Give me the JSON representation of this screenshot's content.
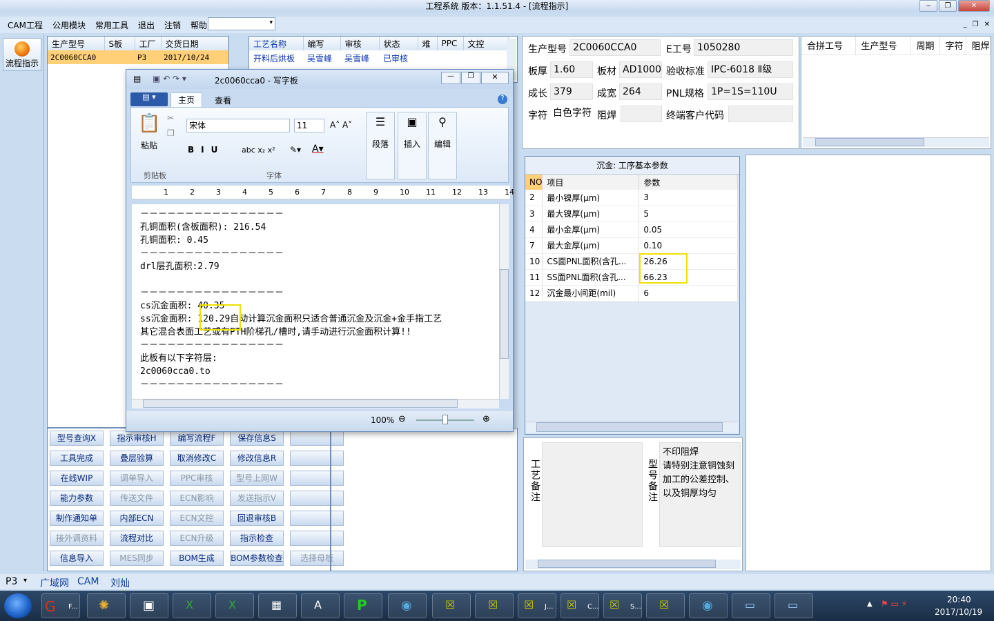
{
  "window": {
    "title": "工程系统   版本：1.1.51.4 - [流程指示]"
  },
  "menu": [
    "CAM工程",
    "公用模块",
    "常用工具",
    "退出",
    "注销",
    "帮助"
  ],
  "sidebar": {
    "flow_label": "流程指示"
  },
  "orders": {
    "headers": [
      "生产型号",
      "S板",
      "工厂",
      "交货日期"
    ],
    "row": [
      "2C0060CCA0",
      "",
      "P3",
      "2017/10/24"
    ]
  },
  "process": {
    "headers": [
      "工艺名称",
      "编写",
      "审核",
      "状态",
      "难",
      "PPC",
      "文控"
    ],
    "row": [
      "开料后烘板",
      "吴雪峰",
      "吴雪峰",
      "已审核",
      "",
      "",
      ""
    ]
  },
  "buttons": [
    [
      {
        "l": "型号查询X",
        "d": false
      },
      {
        "l": "指示审核H",
        "d": false
      },
      {
        "l": "编写流程F",
        "d": false
      },
      {
        "l": "保存信息S",
        "d": false
      },
      {
        "l": "",
        "d": false
      }
    ],
    [
      {
        "l": "工具完成",
        "d": false
      },
      {
        "l": "叠层验算",
        "d": false
      },
      {
        "l": "取消修改C",
        "d": false
      },
      {
        "l": "修改信息R",
        "d": false
      },
      {
        "l": "",
        "d": false
      }
    ],
    [
      {
        "l": "在线WIP",
        "d": false
      },
      {
        "l": "调单导入",
        "d": true
      },
      {
        "l": "PPC审核",
        "d": true
      },
      {
        "l": "型号上网W",
        "d": true
      },
      {
        "l": "",
        "d": false
      }
    ],
    [
      {
        "l": "能力参数",
        "d": false
      },
      {
        "l": "传送文件",
        "d": true
      },
      {
        "l": "ECN影响",
        "d": true
      },
      {
        "l": "发送指示V",
        "d": true
      },
      {
        "l": "",
        "d": false
      }
    ],
    [
      {
        "l": "制作通知单",
        "d": false
      },
      {
        "l": "内部ECN",
        "d": false
      },
      {
        "l": "ECN文控",
        "d": true
      },
      {
        "l": "回退审核B",
        "d": false
      },
      {
        "l": "",
        "d": false
      }
    ],
    [
      {
        "l": "接外调资料",
        "d": true
      },
      {
        "l": "流程对比",
        "d": false
      },
      {
        "l": "ECN升级",
        "d": true
      },
      {
        "l": "指示检查",
        "d": false
      },
      {
        "l": "",
        "d": false
      }
    ],
    [
      {
        "l": "信息导入",
        "d": false
      },
      {
        "l": "MES同步",
        "d": true
      },
      {
        "l": "BOM生成",
        "d": false
      },
      {
        "l": "BOM参数检查",
        "d": false
      },
      {
        "l": "选择母板",
        "d": true
      }
    ]
  ],
  "info": {
    "rows": [
      [
        [
          "生产型号",
          "2C0060CCA0"
        ],
        [
          "E工号",
          "1050280"
        ]
      ],
      [
        [
          "板厚",
          "1.60"
        ],
        [
          "板材",
          "AD1000"
        ],
        [
          "验收标准",
          "IPC-6018 Ⅱ级"
        ]
      ],
      [
        [
          "成长",
          "379"
        ],
        [
          "成宽",
          "264"
        ],
        [
          "PNL规格",
          "1P=1S=110U"
        ]
      ],
      [
        [
          "字符",
          "白色字符"
        ],
        [
          "阻焊",
          ""
        ],
        [
          "终端客户代码",
          ""
        ]
      ]
    ]
  },
  "combine": {
    "headers": [
      "合拼工号",
      "生产型号",
      "周期",
      "字符",
      "阻焊"
    ]
  },
  "params": {
    "caption": "沉金: 工序基本参数",
    "headers": [
      "NO",
      "项目",
      "参数"
    ],
    "rows": [
      [
        "2",
        "最小镍厚(μm)",
        "3"
      ],
      [
        "3",
        "最大镍厚(μm)",
        "5"
      ],
      [
        "4",
        "最小金厚(μm)",
        "0.05"
      ],
      [
        "7",
        "最大金厚(μm)",
        "0.10"
      ],
      [
        "10",
        "CS面PNL面积(含孔...",
        "26.26"
      ],
      [
        "11",
        "SS面PNL面积(含孔...",
        "66.23"
      ],
      [
        "12",
        "沉金最小间距(mil)",
        "6"
      ]
    ]
  },
  "notes": {
    "process_label": "工艺备注",
    "model_label": "型号备注",
    "model_text": [
      "不印阻焊",
      "请特别注意铜蚀刻",
      "加工的公差控制、",
      "以及铜厚均匀"
    ]
  },
  "wordpad": {
    "title": "2c0060cca0 - 写字板",
    "tabs": [
      "主页",
      "查看"
    ],
    "font": "宋体",
    "size": "11",
    "groups": [
      "剪贴板",
      "字体",
      "段落",
      "插入",
      "编辑"
    ],
    "paste": "粘贴",
    "zoom": "100%",
    "lines": [
      "－－－－－－－－－－－－－－－－",
      "孔铜面积(含板面积): 216.54",
      "孔铜面积: 0.45",
      "－－－－－－－－－－－－－－－－",
      "drl层孔面积:2.79",
      "",
      "－－－－－－－－－－－－－－－－",
      "cs沉金面积: 40.35",
      "ss沉金面积: 120.29自动计算沉金面积只适合普通沉金及沉金+金手指工艺",
      "其它混合表面工艺或有PTH阶梯孔/槽时,请手动进行沉金面积计算!!",
      "－－－－－－－－－－－－－－－－",
      "此板有以下字符层:",
      "2c0060cca0.to",
      "－－－－－－－－－－－－－－－－"
    ],
    "ruler": [
      "1",
      "2",
      "3",
      "4",
      "5",
      "6",
      "7",
      "8",
      "9",
      "10",
      "11",
      "12",
      "13",
      "14"
    ]
  },
  "status": {
    "factory": "P3",
    "items": [
      "广域网",
      "CAM",
      "刘灿"
    ]
  },
  "clock": {
    "time": "20:40",
    "date": "2017/10/19"
  },
  "taskbar": {
    "labels": [
      "F...",
      "J...",
      "C...",
      "S..."
    ]
  }
}
